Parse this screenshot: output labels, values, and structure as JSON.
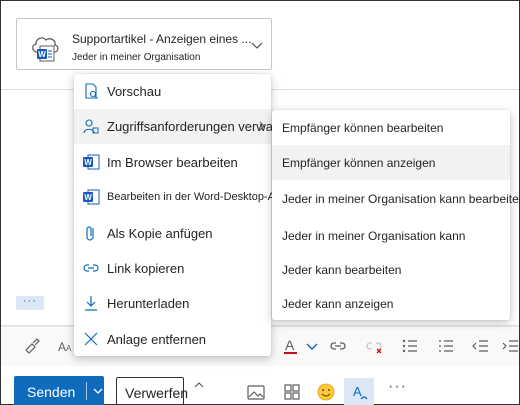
{
  "attachment": {
    "title": "Supportartikel - Anzeigen eines ...",
    "subtitle": "Jeder in meiner Organisation",
    "icon": "word-cloud-icon"
  },
  "context_menu": {
    "items": [
      {
        "label": "Vorschau",
        "icon": "preview-icon"
      },
      {
        "label": "Zugriffsanforderungen verwalten",
        "icon": "manage-access-icon",
        "has_submenu": true,
        "active": true
      },
      {
        "label": "Im Browser bearbeiten",
        "icon": "word-icon"
      },
      {
        "label": "Bearbeiten in der Word-Desktop-App",
        "icon": "word-icon"
      },
      {
        "label": "Als Kopie anfügen",
        "icon": "paperclip-icon"
      },
      {
        "label": "Link kopieren",
        "icon": "link-icon"
      },
      {
        "label": "Herunterladen",
        "icon": "download-icon"
      },
      {
        "label": "Anlage entfernen",
        "icon": "close-icon"
      }
    ]
  },
  "submenu": {
    "items": [
      {
        "label": "Empfänger können bearbeiten"
      },
      {
        "label": "Empfänger können anzeigen",
        "active": true
      },
      {
        "label": "Jeder in meiner Organisation kann bearbeiten"
      },
      {
        "label": "Jeder in meiner Organisation kann"
      },
      {
        "label": "Jeder kann bearbeiten"
      },
      {
        "label": "Jeder kann anzeigen"
      }
    ]
  },
  "body": {
    "more_dots": "···"
  },
  "actions": {
    "send_label": "Senden",
    "discard_label": "Verwerfen",
    "more_label": "···"
  },
  "colors": {
    "accent": "#0f6cbd",
    "font_color_red": "#c50f1f",
    "word_blue": "#185abd",
    "hover_bg": "#f3f2f1"
  }
}
